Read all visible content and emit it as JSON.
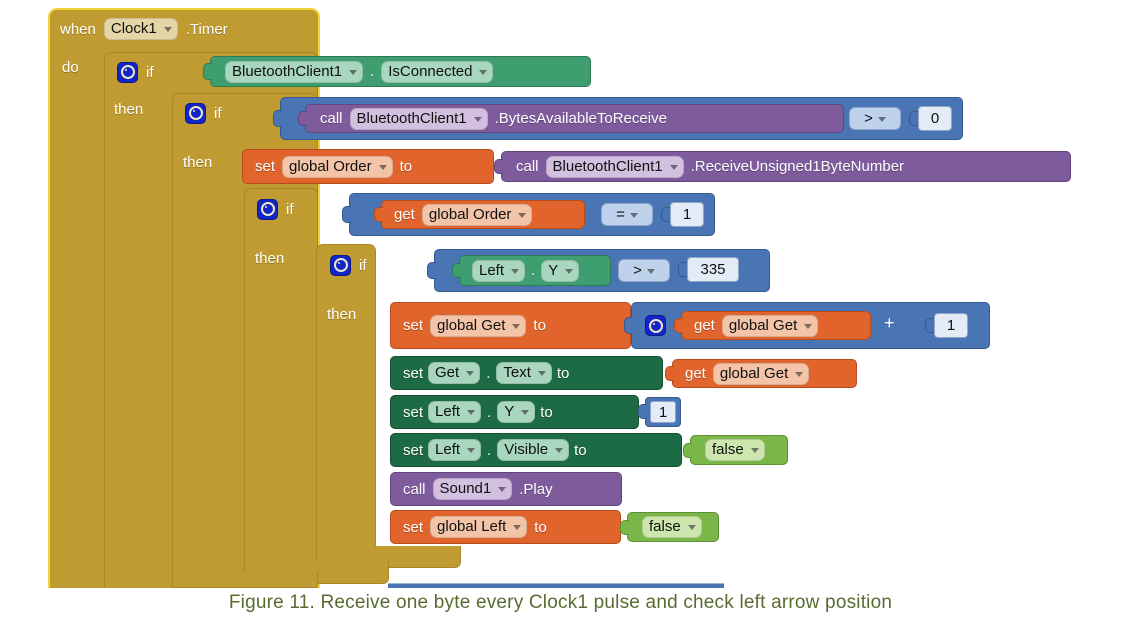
{
  "figure": {
    "caption": "Figure 11. Receive one byte every Clock1 pulse and check left arrow position"
  },
  "colors": {
    "event_gold": "#BF9B31",
    "event_border": "#F2D33C",
    "component_green": "#3F9E6F",
    "method_purple": "#7E5B9C",
    "math_logic_blue": "#4A75B5",
    "variable_orange": "#E0642C",
    "setter_dark_green": "#1D6B44",
    "logic_light_green": "#7AB648",
    "caption_text": "#5A6B32"
  },
  "blocks": {
    "event": {
      "when_label": "when",
      "component": "Clock1",
      "event_name": ".Timer",
      "do_label": "do"
    },
    "if1": {
      "if_label": "if",
      "then_label": "then",
      "condition": {
        "component": "BluetoothClient1",
        "dot": ".",
        "property": "IsConnected"
      }
    },
    "if2": {
      "if_label": "if",
      "then_label": "then",
      "condition": {
        "call_label": "call",
        "component": "BluetoothClient1",
        "method": ".BytesAvailableToReceive",
        "operator": ">",
        "value": "0"
      }
    },
    "set_order": {
      "set_label": "set",
      "variable": "global Order",
      "to_label": "to",
      "value": {
        "call_label": "call",
        "component": "BluetoothClient1",
        "method": ".ReceiveUnsigned1ByteNumber"
      }
    },
    "if3": {
      "if_label": "if",
      "then_label": "then",
      "condition": {
        "get_label": "get",
        "variable": "global Order",
        "operator": "=",
        "value": "1"
      }
    },
    "if4": {
      "if_label": "if",
      "then_label": "then",
      "condition": {
        "component": "Left",
        "dot": ".",
        "property": "Y",
        "operator": ">",
        "value": "335"
      }
    },
    "statements": [
      {
        "type": "set-variable",
        "set_label": "set",
        "variable": "global Get",
        "to_label": "to",
        "expr": {
          "get_label": "get",
          "variable": "global Get",
          "operator": "+",
          "value": "1"
        }
      },
      {
        "type": "set-property",
        "set_label": "set",
        "component": "Get",
        "dot": ".",
        "property": "Text",
        "to_label": "to",
        "value_get_label": "get",
        "value_variable": "global Get"
      },
      {
        "type": "set-property-number",
        "set_label": "set",
        "component": "Left",
        "dot": ".",
        "property": "Y",
        "to_label": "to",
        "value": "1"
      },
      {
        "type": "set-property-bool",
        "set_label": "set",
        "component": "Left",
        "dot": ".",
        "property": "Visible",
        "to_label": "to",
        "value": "false"
      },
      {
        "type": "call-method",
        "call_label": "call",
        "component": "Sound1",
        "method": ".Play"
      },
      {
        "type": "set-variable-bool",
        "set_label": "set",
        "variable": "global Left",
        "to_label": "to",
        "value": "false"
      }
    ]
  }
}
